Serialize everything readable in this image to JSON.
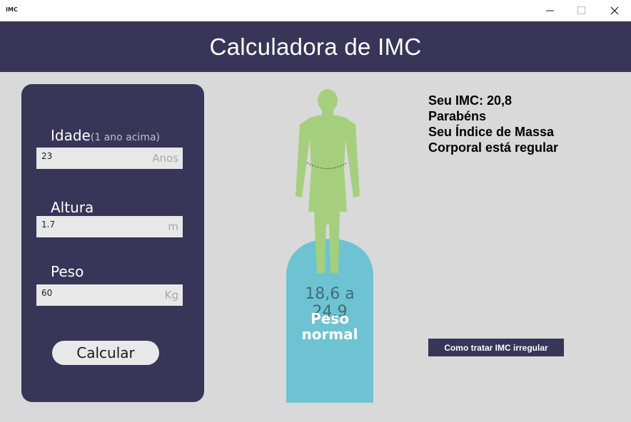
{
  "window": {
    "app_icon_text": "IMC",
    "controls": [
      "minimize",
      "maximize",
      "close"
    ]
  },
  "header": {
    "title": "Calculadora de IMC"
  },
  "form": {
    "age": {
      "label": "Idade",
      "hint": "(1 ano acima)",
      "value": "23",
      "unit": "Anos"
    },
    "height": {
      "label": "Altura",
      "value": "1.7",
      "unit": "m"
    },
    "weight": {
      "label": "Peso",
      "value": "60",
      "unit": "Kg"
    },
    "calculate_label": "Calcular"
  },
  "figure": {
    "range": "18,6 a 24,9",
    "category": "Peso\nnormal",
    "body_color": "#a5cf7d",
    "badge_color": "#6ec3d2"
  },
  "result": {
    "lines": [
      "Seu IMC: 20,8",
      "Parabéns",
      "Seu Índice de Massa",
      "Corporal está regular"
    ]
  },
  "help_button_label": "Como tratar IMC irregular",
  "colors": {
    "primary": "#383558",
    "background": "#d9d9d9",
    "field": "#e8e8e8"
  }
}
